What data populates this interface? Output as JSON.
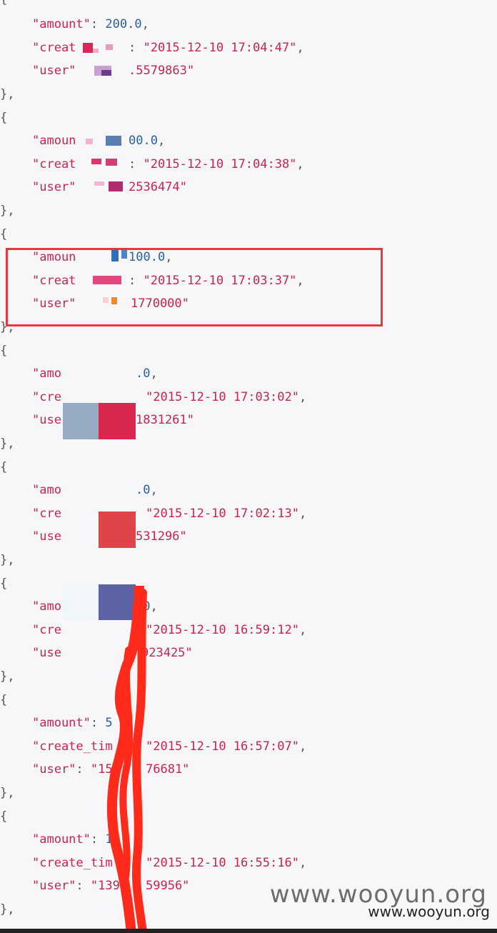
{
  "json_viewer": {
    "open_brace": "{",
    "close_brace": "},",
    "records": [
      {
        "amount_key": "\"amount\"",
        "amount_value": "200.0",
        "create_key": "\"creat",
        "create_value": "\"2015-12-10 17:04:47\"",
        "user_key": "\"user\"",
        "user_value": ".5579863\""
      },
      {
        "amount_key": "\"amoun",
        "amount_value": "00.0",
        "create_key": "\"creat",
        "create_value": "\"2015-12-10 17:04:38\"",
        "user_key": "\"user\"",
        "user_value": "2536474\""
      },
      {
        "amount_key": "\"amoun",
        "amount_value": "100.0",
        "create_key": "\"creat",
        "create_value": "\"2015-12-10 17:03:37\"",
        "user_key": "\"user\"",
        "user_value": "1770000\""
      },
      {
        "amount_key": "\"amo",
        "amount_value": ".0",
        "create_key": "\"cre",
        "create_value": "\"2015-12-10 17:03:02\"",
        "user_key": "\"use",
        "user_value": "1831261\""
      },
      {
        "amount_key": "\"amo",
        "amount_value": ".0",
        "create_key": "\"cre",
        "create_value": "\"2015-12-10 17:02:13\"",
        "user_key": "\"use",
        "user_value": "531296\""
      },
      {
        "amount_key": "\"amo",
        "amount_value": ".0",
        "create_key": "\"cre",
        "create_value": "\"2015-12-10 16:59:12\"",
        "user_key": "\"use",
        "user_value": "923425\""
      },
      {
        "amount_key": "\"amount\"",
        "amount_value": "5",
        "create_key": "\"create_tim",
        "create_value": "\"2015-12-10 16:57:07\"",
        "user_key": "\"user\"",
        "user_value": "\"15",
        "user_value_tail": "76681\""
      },
      {
        "amount_key": "\"amount\"",
        "amount_value": "11",
        "create_key": "\"create_tim",
        "create_value": "\"2015-12-10 16:55:16\"",
        "user_key": "\"user\"",
        "user_value": "\"139",
        "user_value_tail": "59956\""
      }
    ]
  },
  "watermark": {
    "large": "www.wooyun.org",
    "small": "www.wooyun.org"
  },
  "colors": {
    "key": "#c7254e",
    "number": "#2b5f9e",
    "highlight_border": "#e5393c",
    "scribble": "#ff2a1a"
  }
}
